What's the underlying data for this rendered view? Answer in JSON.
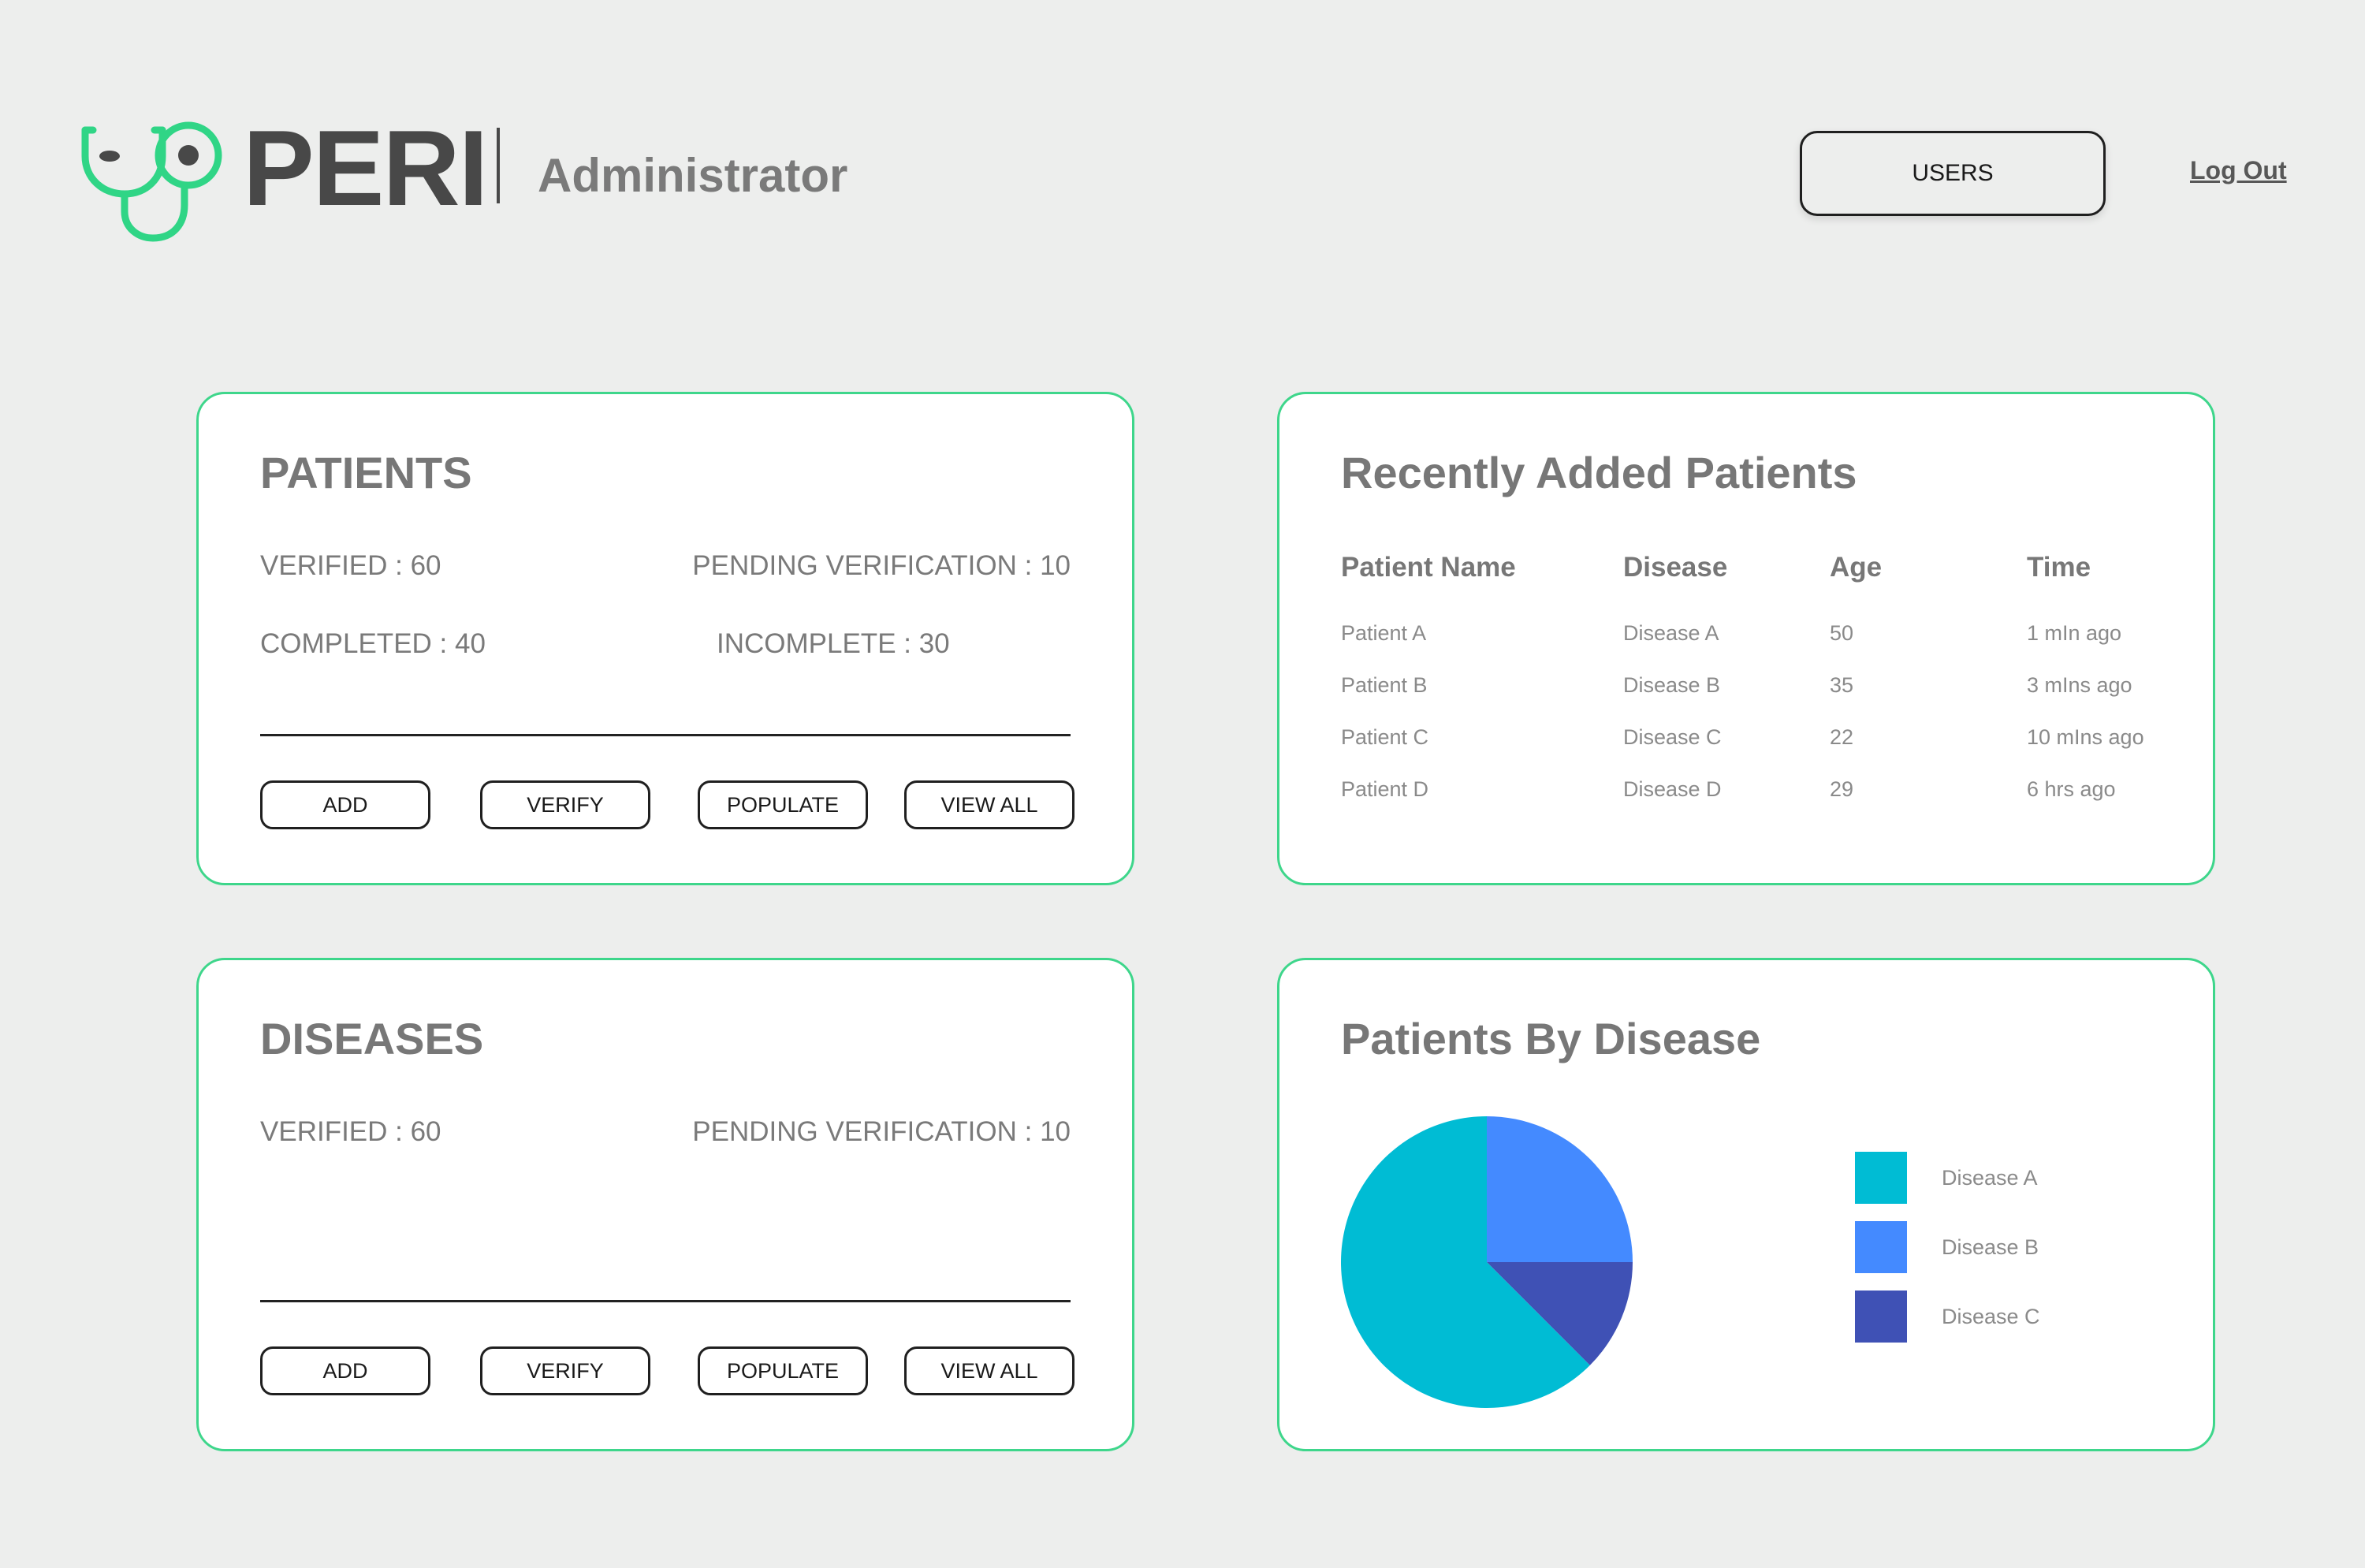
{
  "header": {
    "brand": "PERI",
    "role": "Administrator",
    "users_label": "USERS",
    "logout_label": "Log Out",
    "brand_color": "#30d586"
  },
  "patients_card": {
    "title": "PATIENTS",
    "verified": "VERIFIED : 60",
    "pending": "PENDING VERIFICATION : 10",
    "completed": "COMPLETED : 40",
    "incomplete": "INCOMPLETE : 30",
    "buttons": [
      "ADD",
      "VERIFY",
      "POPULATE",
      "VIEW ALL"
    ]
  },
  "recent_card": {
    "title": "Recently Added Patients",
    "columns": [
      "Patient Name",
      "Disease",
      "Age",
      "Time"
    ],
    "rows": [
      [
        "Patient A",
        "Disease A",
        "50",
        "1 mIn ago"
      ],
      [
        "Patient B",
        "Disease B",
        "35",
        "3 mIns ago"
      ],
      [
        "Patient C",
        "Disease C",
        "22",
        "10 mIns ago"
      ],
      [
        "Patient D",
        "Disease D",
        "29",
        "6 hrs ago"
      ]
    ]
  },
  "diseases_card": {
    "title": "DISEASES",
    "verified": "VERIFIED : 60",
    "pending": "PENDING VERIFICATION : 10",
    "buttons": [
      "ADD",
      "VERIFY",
      "POPULATE",
      "VIEW ALL"
    ]
  },
  "chart_card": {
    "title": "Patients By Disease"
  },
  "chart_data": {
    "type": "pie",
    "title": "Patients By Disease",
    "labels": [
      "Disease A",
      "Disease B",
      "Disease C"
    ],
    "values": [
      62.5,
      25,
      12.5
    ],
    "colors": [
      "#00bcd4",
      "#448aff",
      "#3f51b5"
    ],
    "legend": "right"
  }
}
